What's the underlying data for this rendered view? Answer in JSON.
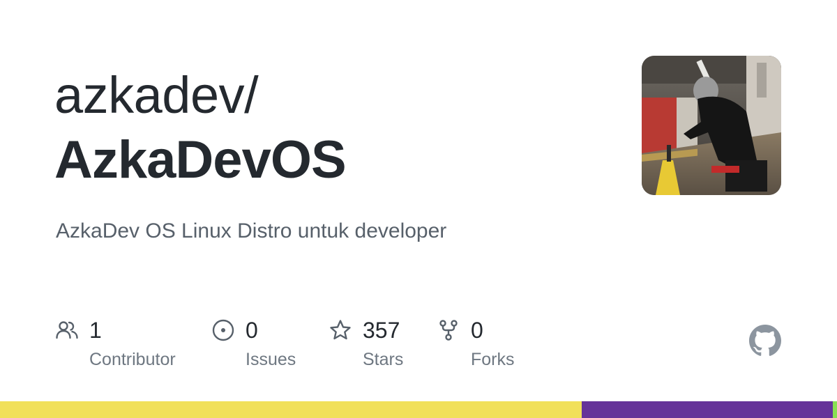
{
  "repo": {
    "owner": "azkadev/",
    "name": "AzkaDevOS",
    "description": "AzkaDev OS Linux Distro untuk developer"
  },
  "stats": [
    {
      "icon": "people-icon",
      "count": "1",
      "label": "Contributor"
    },
    {
      "icon": "issue-opened-icon",
      "count": "0",
      "label": "Issues"
    },
    {
      "icon": "star-icon",
      "count": "357",
      "label": "Stars"
    },
    {
      "icon": "repo-forked-icon",
      "count": "0",
      "label": "Forks"
    }
  ],
  "language_bar": [
    {
      "color": "#f1e05a",
      "share": 0.695
    },
    {
      "color": "#663399",
      "share": 0.3
    },
    {
      "color": "#89e051",
      "share": 0.005
    }
  ],
  "colors": {
    "title": "#24292f",
    "description": "#57606a",
    "stat_label": "#6e7781",
    "icon": "#57606a"
  }
}
